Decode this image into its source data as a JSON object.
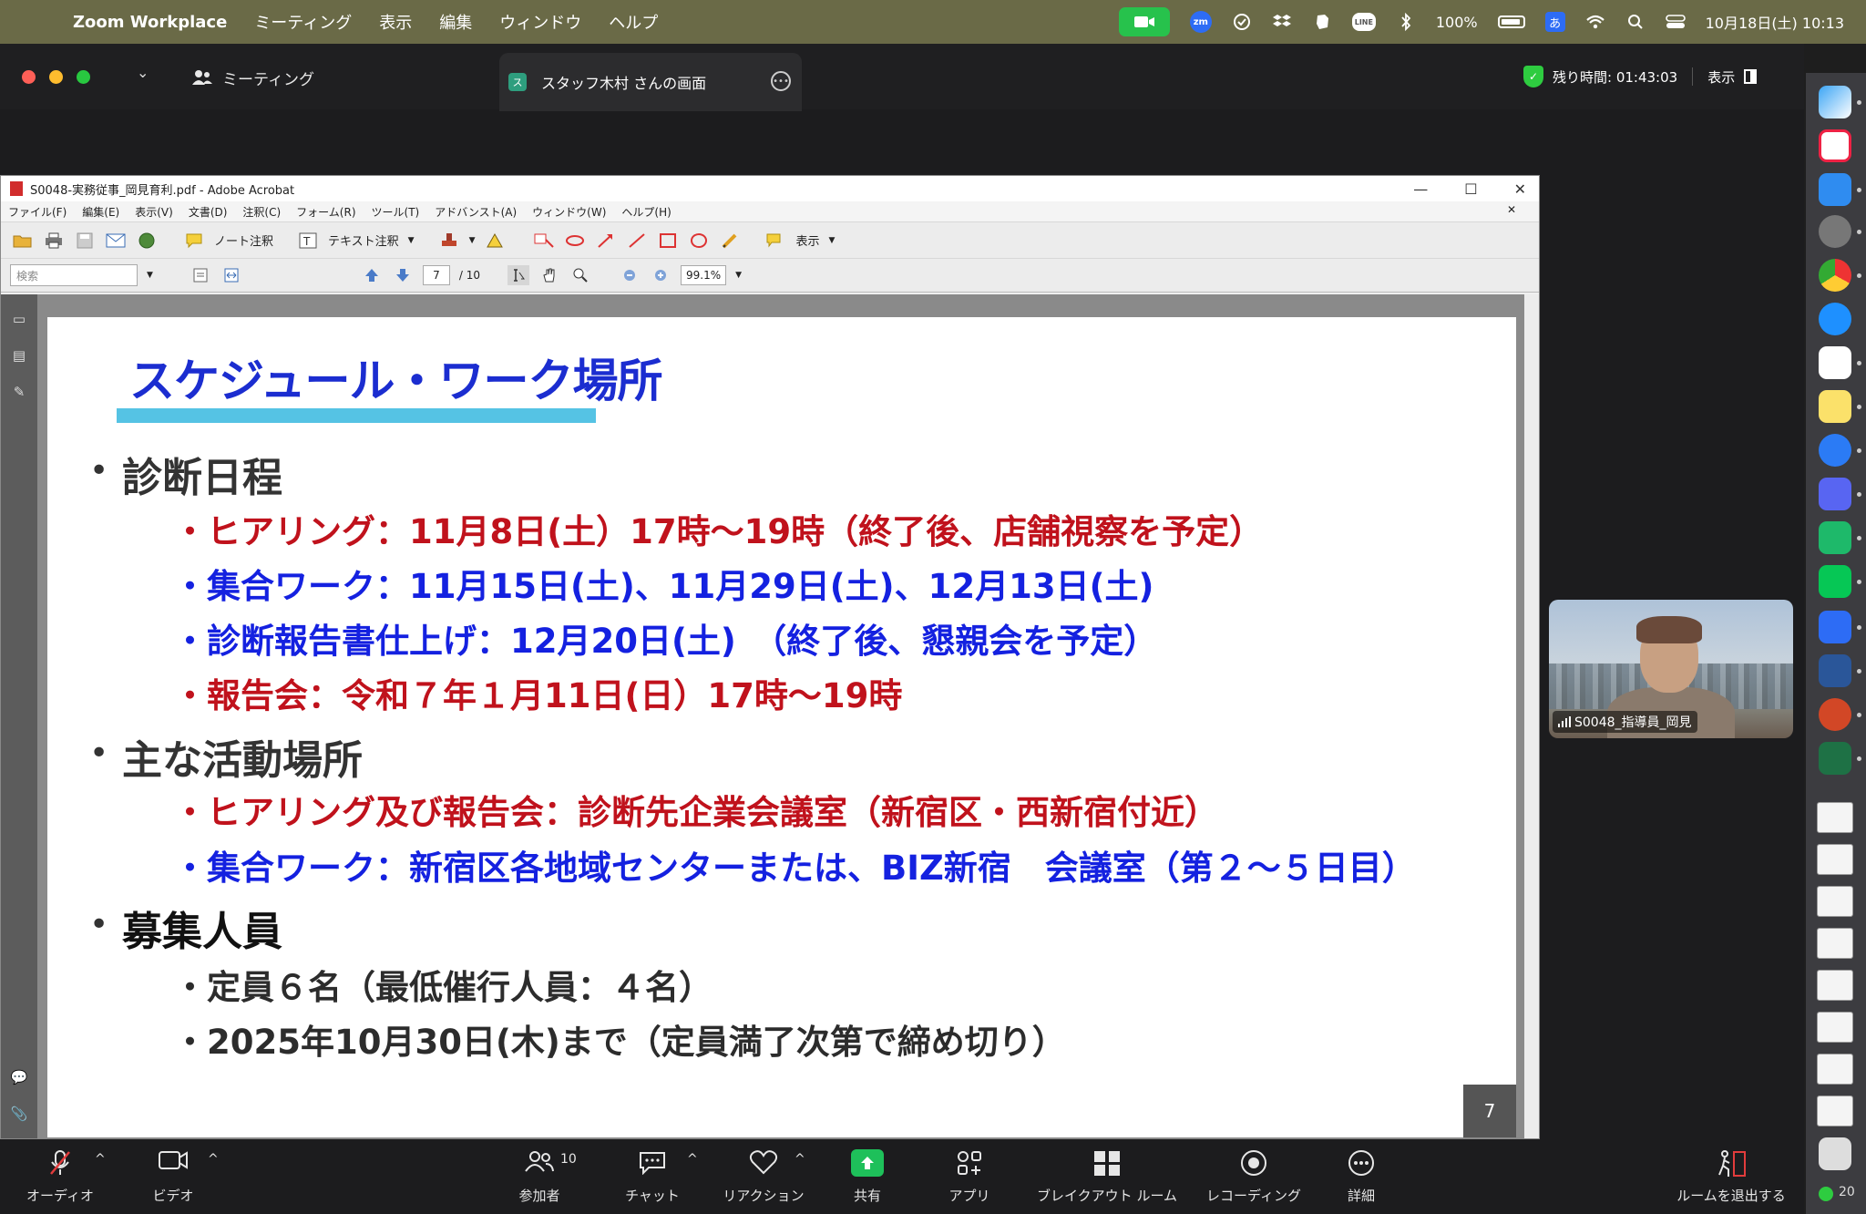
{
  "menubar": {
    "app_name": "Zoom Workplace",
    "menus": [
      "ミーティング",
      "表示",
      "編集",
      "ウィンドウ",
      "ヘルプ"
    ],
    "battery": "100%",
    "ime": "あ",
    "datetime": "10月18日(土) 10:13",
    "zm_label": "zm",
    "line_label": "LINE"
  },
  "zoom": {
    "meeting_tab": "ミーティング",
    "share_tab": "スタッフ木村 さんの画面",
    "share_icon_char": "ス",
    "time_remaining": "残り時間: 01:43:03",
    "view_button": "表示",
    "participants_count": "10"
  },
  "acrobat": {
    "window_title": "S0048-実務従事_岡見育利.pdf - Adobe Acrobat",
    "menus": [
      "ファイル(F)",
      "編集(E)",
      "表示(V)",
      "文書(D)",
      "注釈(C)",
      "フォーム(R)",
      "ツール(T)",
      "アドバンスト(A)",
      "ウィンドウ(W)",
      "ヘルプ(H)"
    ],
    "toolbar": {
      "note_comment": "ノート注釈",
      "text_comment": "テキスト注釈",
      "show_button": "表示"
    },
    "search_placeholder": "検索",
    "page_current": "7",
    "page_total": "/ 10",
    "zoom_level": "99.1%"
  },
  "slide": {
    "title": "スケジュール・ワーク場所",
    "section1": "診断日程",
    "s1_lines": [
      "・ヒアリング：11月8日(土）17時～19時（終了後、店舗視察を予定）",
      "・集合ワーク：11月15日(土)、11月29日(土)、12月13日(土)",
      "・診断報告書仕上げ：12月20日(土)　（終了後、懇親会を予定）",
      "・報告会：令和７年１月11日(日）17時～19時"
    ],
    "section2": "主な活動場所",
    "s2_lines": [
      "・ヒアリング及び報告会：診断先企業会議室（新宿区・西新宿付近）",
      "・集合ワーク：新宿区各地域センターまたは、BIZ新宿　会議室（第２～５日目）"
    ],
    "section3": "募集人員",
    "s3_lines": [
      "・定員６名（最低催行人員：４名）",
      "・2025年10月30日(木)まで（定員満了次第で締め切り）"
    ],
    "bullet": "•",
    "page_number": "7",
    "colors": {
      "red": "#c0121c",
      "blue": "#1421e0",
      "title_blue": "#1b2dd0",
      "underline": "#55c3e4"
    }
  },
  "video": {
    "participant_name": "S0048_指導員_岡見"
  },
  "bottom_toolbar": {
    "audio": "オーディオ",
    "video": "ビデオ",
    "participants": "参加者",
    "chat": "チャット",
    "reactions": "リアクション",
    "share": "共有",
    "apps": "アプリ",
    "breakout": "ブレイクアウト ルーム",
    "recording": "レコーディング",
    "more": "詳細",
    "leave": "ルームを退出する"
  },
  "dock": {
    "partial_label": "20"
  }
}
